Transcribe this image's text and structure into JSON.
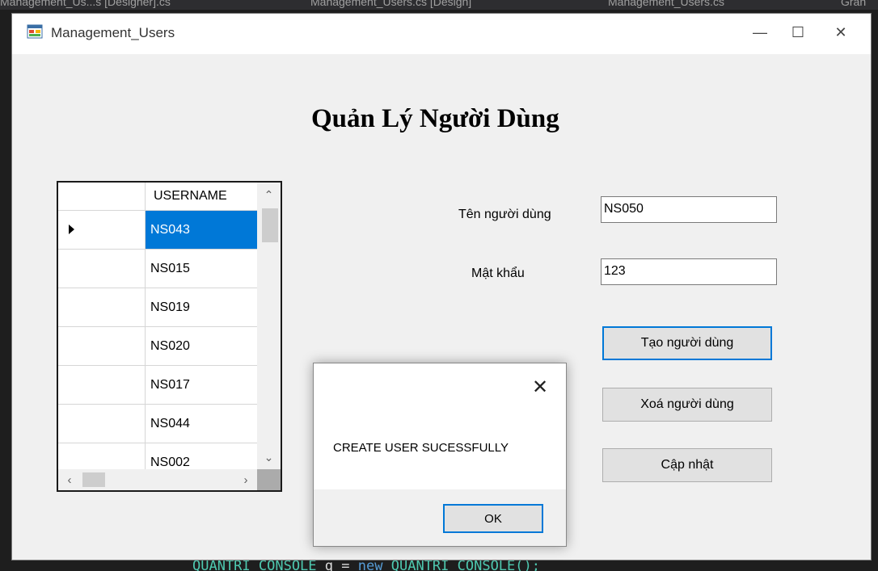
{
  "background": {
    "tabs": [
      "Management_Us...s [Designer].cs",
      "Management_Users.cs [Design]",
      "Management_Users.cs",
      "Gran"
    ],
    "code_line": {
      "type_name": "QUANTRI_CONSOLE",
      "var_name": "q",
      "op": "=",
      "keyword": "new",
      "ctor": "QUANTRI_CONSOLE();"
    }
  },
  "window": {
    "title": "Management_Users",
    "controls": {
      "minimize": "—",
      "maximize": "☐",
      "close": "✕"
    }
  },
  "form": {
    "heading": "Quản Lý Người Dùng",
    "grid": {
      "column": "USERNAME",
      "rows": [
        "NS043",
        "NS015",
        "NS019",
        "NS020",
        "NS017",
        "NS044",
        "NS002"
      ],
      "selected_index": 0
    },
    "username_label": "Tên người dùng",
    "username_value": "NS050",
    "password_label": "Mật khẩu",
    "password_value": "123",
    "create_button": "Tạo người dùng",
    "delete_button": "Xoá người dùng",
    "update_button": "Cập nhật"
  },
  "dialog": {
    "message": "CREATE USER SUCESSFULLY",
    "ok_button": "OK",
    "close": "✕"
  },
  "colors": {
    "selection": "#0078d7",
    "window_bg": "#f0f0f0"
  }
}
